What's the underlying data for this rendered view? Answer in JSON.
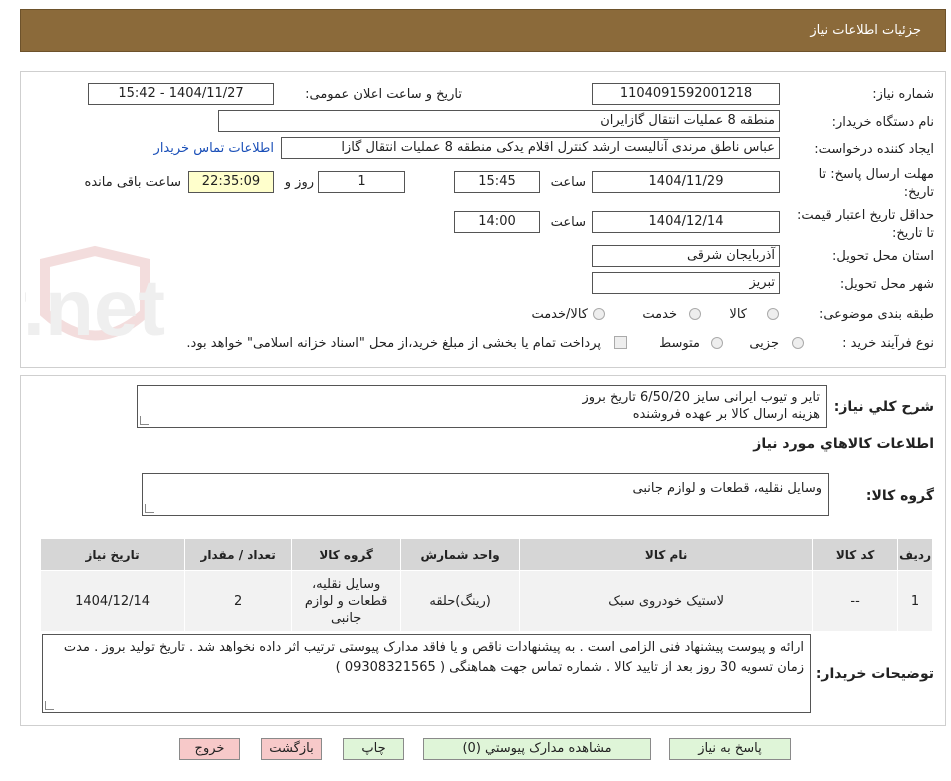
{
  "header": {
    "title": "جزئیات اطلاعات نیاز"
  },
  "watermark": {
    "text": "AriaTender.net"
  },
  "form": {
    "need_number_label": "شماره نیاز:",
    "need_number": "1104091592001218",
    "announce_label": "تاریخ و ساعت اعلان عمومی:",
    "announce_value": "1404/11/27 - 15:42",
    "buyer_org_label": "نام دستگاه خریدار:",
    "buyer_org": "منطقه 8 عملیات انتقال گازایران",
    "requester_label": "ایجاد کننده درخواست:",
    "requester": "عباس ناطق مرندی آنالیست ارشد کنترل اقلام یدکی منطقه 8 عملیات انتقال گازا",
    "contact_link": "اطلاعات تماس خریدار",
    "deadline_label": "مهلت ارسال پاسخ: تا تاریخ:",
    "deadline_date": "1404/11/29",
    "time_label": "ساعت",
    "deadline_time": "15:45",
    "days_value": "1",
    "days_label": "روز و",
    "remaining_time": "22:35:09",
    "remaining_label": "ساعت باقی مانده",
    "validity_label": "حداقل تاریخ اعتبار قیمت: تا تاریخ:",
    "validity_date": "1404/12/14",
    "validity_time": "14:00",
    "province_label": "استان محل تحویل:",
    "province": "آذربایجان شرقی",
    "city_label": "شهر محل تحویل:",
    "city": "تبریز",
    "category_label": "طبقه بندی موضوعی:",
    "category_options": [
      "کالا",
      "خدمت",
      "کالا/خدمت"
    ],
    "process_label": "نوع فرآیند خرید :",
    "process_options": [
      "جزیی",
      "متوسط"
    ],
    "payment_note": "پرداخت تمام یا بخشی از مبلغ خرید،از محل \"اسناد خزانه اسلامی\" خواهد بود."
  },
  "summary": {
    "label": "شرح کلي نياز:",
    "line1": "تایر و تیوب ایرانی سایز 6/50/20 تاریخ بروز",
    "line2": "هزینه ارسال کالا بر عهده فروشنده"
  },
  "goods": {
    "section_title": "اطلاعات کالاهاي مورد نياز",
    "group_label": "گروه کالا:",
    "group_value": "وسایل نقلیه، قطعات و لوازم جانبی"
  },
  "table": {
    "headers": [
      "رديف",
      "کد کالا",
      "نام کالا",
      "واحد شمارش",
      "گروه کالا",
      "تعداد / مقدار",
      "تاریخ نیاز"
    ],
    "rows": [
      [
        "1",
        "--",
        "لاستیک خودروی سبک",
        "(رینگ)حلقه",
        "وسایل نقلیه، قطعات و لوازم جانبی",
        "2",
        "1404/12/14"
      ]
    ]
  },
  "buyer_notes": {
    "label": "توضیحات خریدار:",
    "text": "ارائه و پیوست پیشنهاد فنی الزامی است . به پیشنهادات ناقص و یا فاقد مدارک پیوستی ترتیب اثر داده نخواهد شد . تاریخ تولید بروز . مدت زمان تسویه 30 روز بعد از تایید کالا . شماره تماس جهت هماهنگی ( 09308321565 )"
  },
  "buttons": {
    "reply": "پاسخ به نیاز",
    "attachments": "مشاهده مدارک پیوستي (0)",
    "print": "چاپ",
    "back": "بازگشت",
    "exit": "خروج"
  }
}
